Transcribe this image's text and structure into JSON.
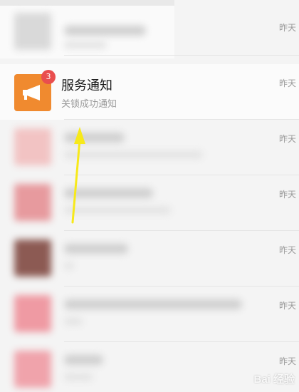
{
  "conversations": {
    "timestamp_label": "昨天",
    "service_notification": {
      "name": "服务通知",
      "preview": "关锁成功通知",
      "unread_count": "3",
      "icon": "megaphone-icon",
      "accent_color": "#f08a2f",
      "badge_color": "#e94e4e"
    },
    "blurred_rows": 6
  },
  "watermark": {
    "text": "Bai 经验"
  },
  "annotation": {
    "arrow_color": "#f7e91a",
    "points_to": "service-notification-row"
  }
}
